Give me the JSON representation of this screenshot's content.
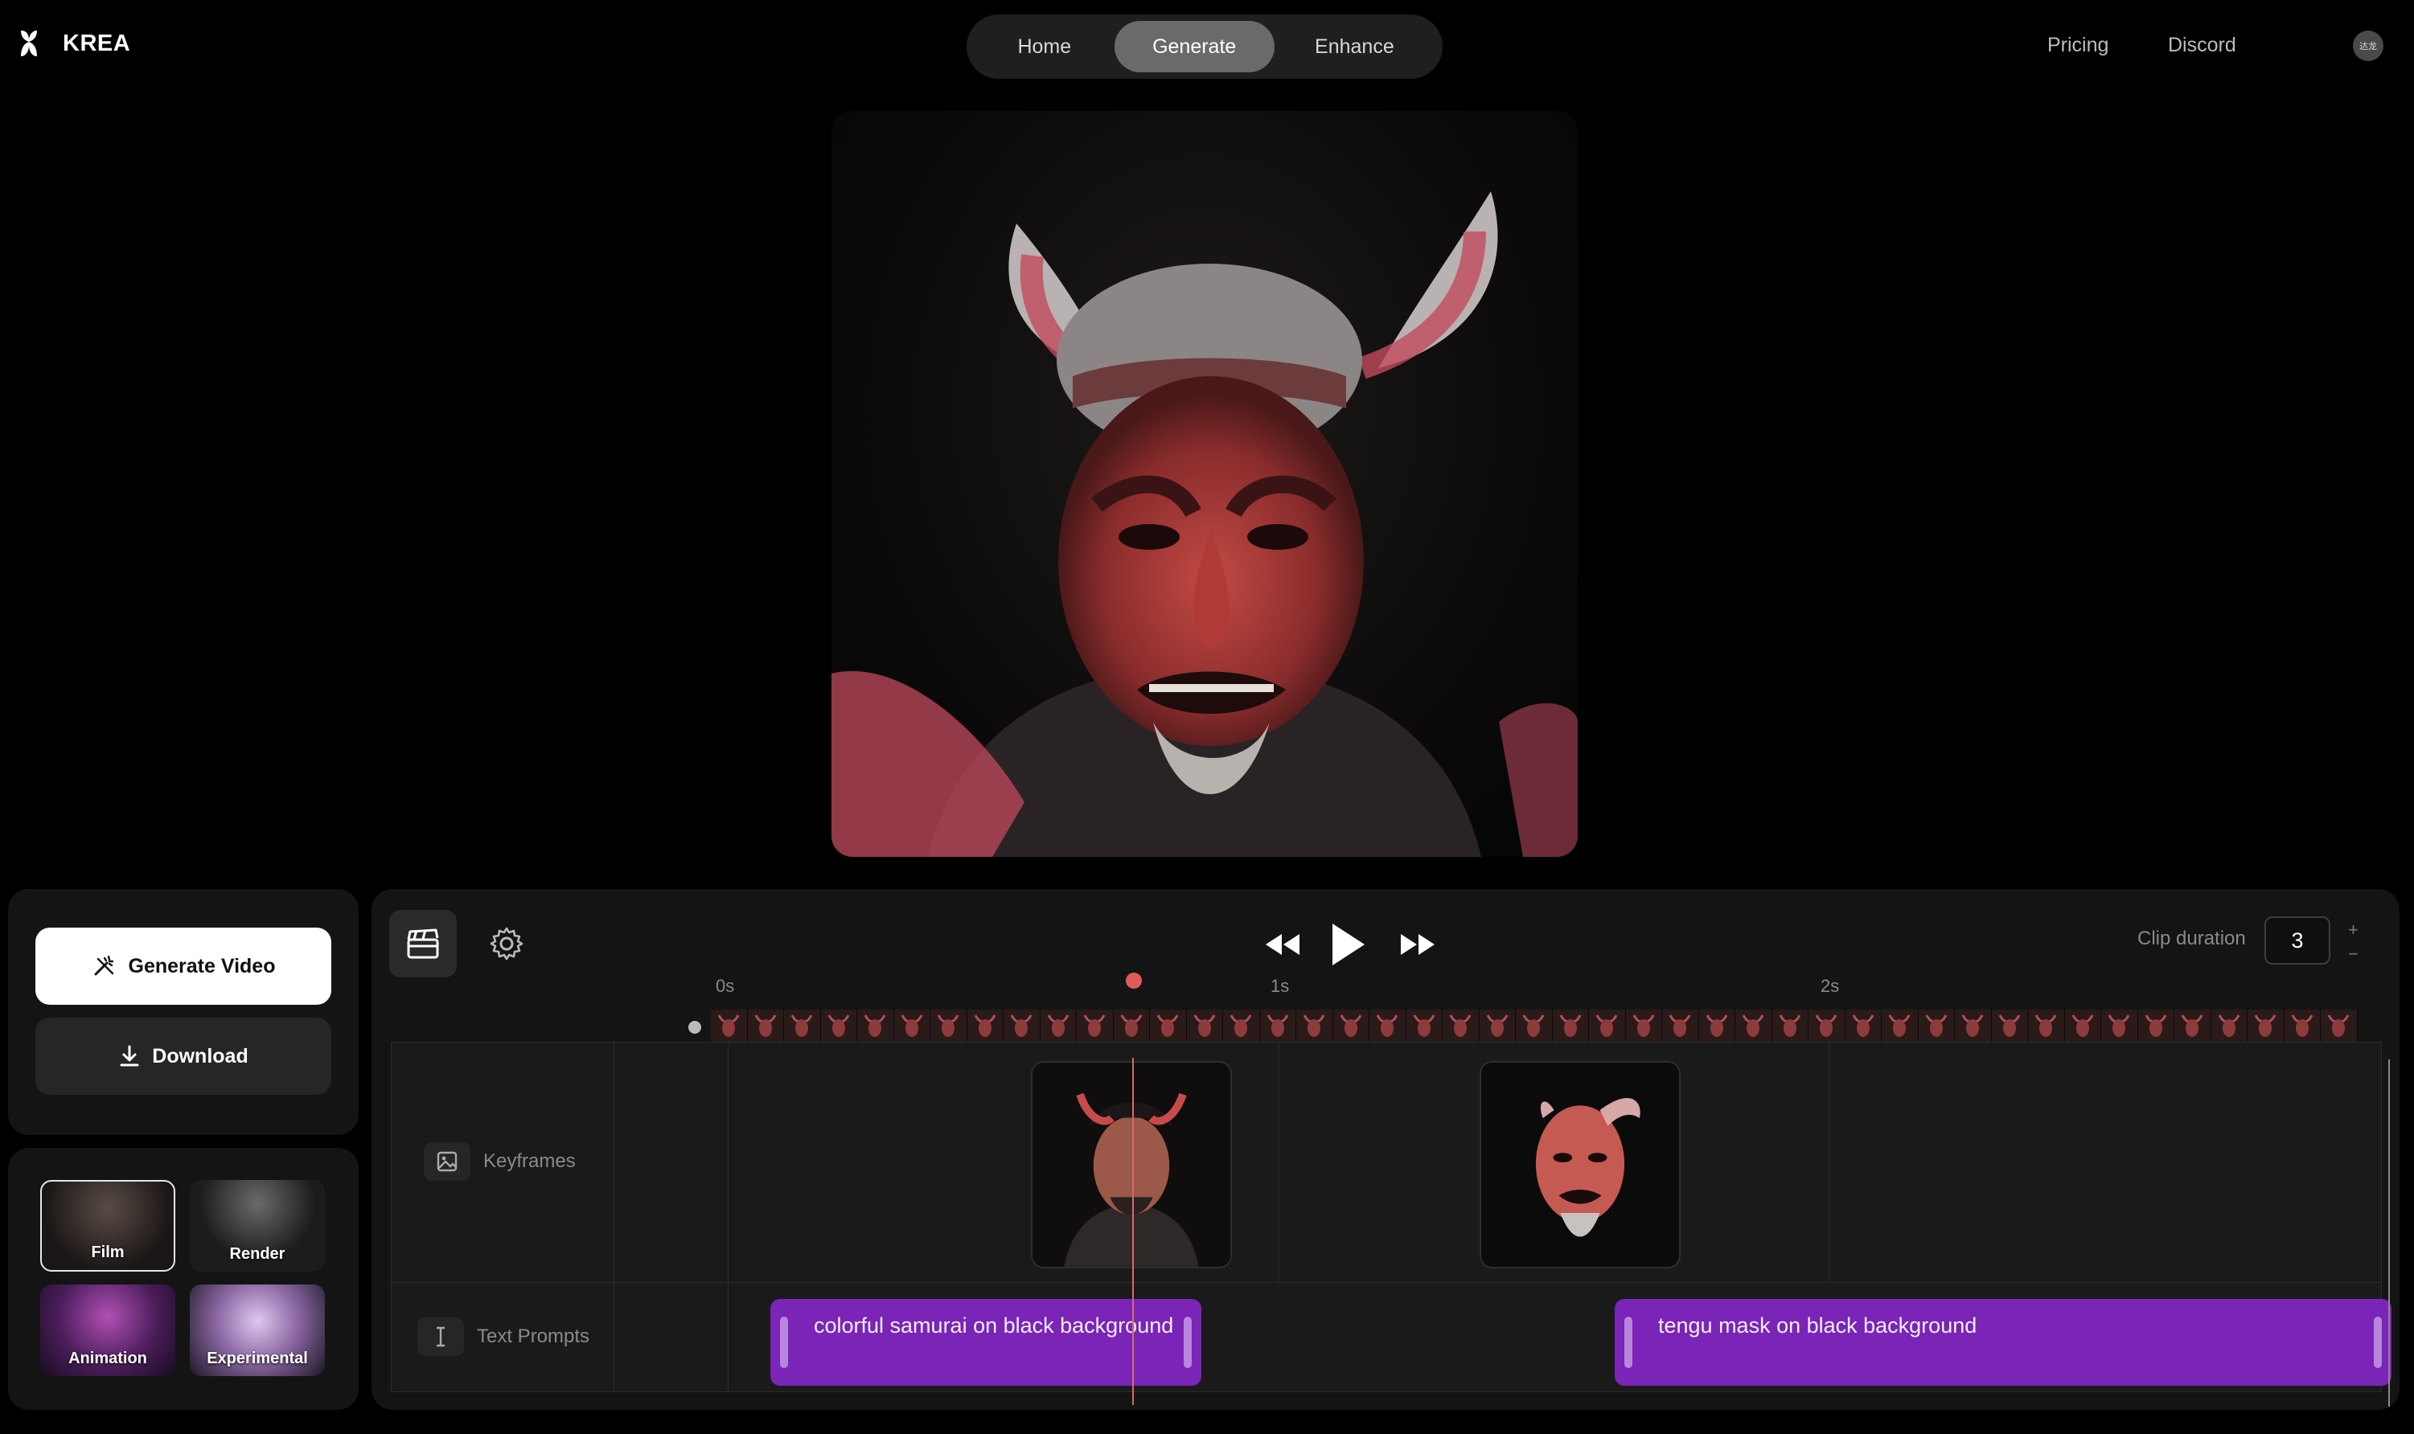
{
  "brand": {
    "name": "KREA"
  },
  "nav": {
    "tabs": [
      {
        "label": "Home"
      },
      {
        "label": "Generate"
      },
      {
        "label": "Enhance"
      }
    ],
    "active": "Generate"
  },
  "header_links": {
    "pricing": "Pricing",
    "discord": "Discord"
  },
  "avatar": {
    "initials": "达龙"
  },
  "actions": {
    "generate_video": "Generate Video",
    "download": "Download"
  },
  "styles": [
    {
      "label": "Film",
      "selected": true
    },
    {
      "label": "Render",
      "selected": false
    },
    {
      "label": "Animation",
      "selected": false
    },
    {
      "label": "Experimental",
      "selected": false
    }
  ],
  "timeline": {
    "clip_duration_label": "Clip duration",
    "clip_duration": "3",
    "plus": "+",
    "minus": "−",
    "ticks": [
      "0s",
      "1s",
      "2s"
    ],
    "tracks": {
      "keyframes": "Keyframes",
      "text_prompts": "Text Prompts"
    },
    "prompts": [
      {
        "text": "colorful samurai on black background"
      },
      {
        "text": "tengu mask on black background"
      }
    ]
  },
  "colors": {
    "accent_purple": "#7a24b8",
    "playhead": "#e05a5a",
    "active_tab": "#6a6a6a"
  },
  "icons": [
    "krea-logo-icon",
    "wand-icon",
    "download-icon",
    "clapper-icon",
    "gear-icon",
    "rewind-icon",
    "play-icon",
    "fast-forward-icon",
    "image-icon",
    "text-cursor-icon"
  ]
}
